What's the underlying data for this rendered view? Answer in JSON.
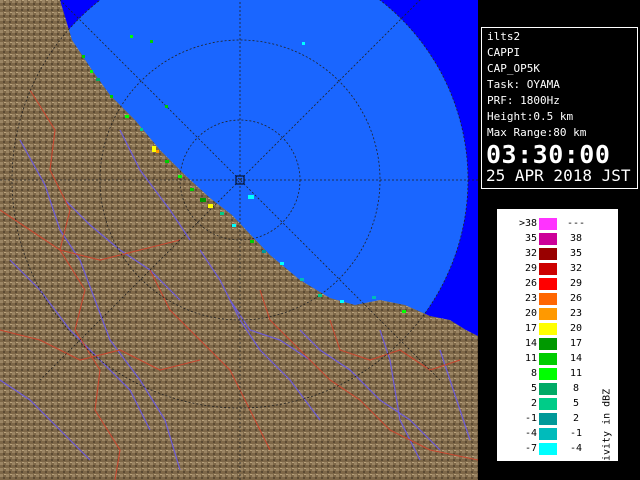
{
  "info": {
    "site": "ilts2",
    "product": "CAPPI",
    "code": "CAP_OP5K",
    "task": "Task: OYAMA",
    "prf": "PRF: 1800Hz",
    "height": "Height:0.5 km",
    "range": "Max Range:80 km",
    "time": "03:30:00",
    "date": "25 APR 2018 JST"
  },
  "legend": {
    "title": "Reflectivity in dBZ",
    "rows": [
      {
        "lo": ">38",
        "hi": "---",
        "color": "#ff33ff"
      },
      {
        "lo": "35",
        "hi": "38",
        "color": "#cc0099"
      },
      {
        "lo": "32",
        "hi": "35",
        "color": "#990000"
      },
      {
        "lo": "29",
        "hi": "32",
        "color": "#cc0000"
      },
      {
        "lo": "26",
        "hi": "29",
        "color": "#ff0000"
      },
      {
        "lo": "23",
        "hi": "26",
        "color": "#ff6600"
      },
      {
        "lo": "20",
        "hi": "23",
        "color": "#ff9900"
      },
      {
        "lo": "17",
        "hi": "20",
        "color": "#ffff00"
      },
      {
        "lo": "14",
        "hi": "17",
        "color": "#009900"
      },
      {
        "lo": "11",
        "hi": "14",
        "color": "#00cc00"
      },
      {
        "lo": "8",
        "hi": "11",
        "color": "#00ff00"
      },
      {
        "lo": "5",
        "hi": "8",
        "color": "#00aa66"
      },
      {
        "lo": "2",
        "hi": "5",
        "color": "#00cc88"
      },
      {
        "lo": "-1",
        "hi": "2",
        "color": "#009999"
      },
      {
        "lo": "-4",
        "hi": "-1",
        "color": "#00bbbb"
      },
      {
        "lo": "-7",
        "hi": "-4",
        "color": "#00ffff"
      }
    ]
  },
  "map": {
    "land_color": "#7d6748",
    "sea_color": "#0000ff",
    "coverage_color": "#1a66ff",
    "river_color": "#6d5cd8",
    "border_color": "#c84830",
    "grid_color": "#222222"
  }
}
